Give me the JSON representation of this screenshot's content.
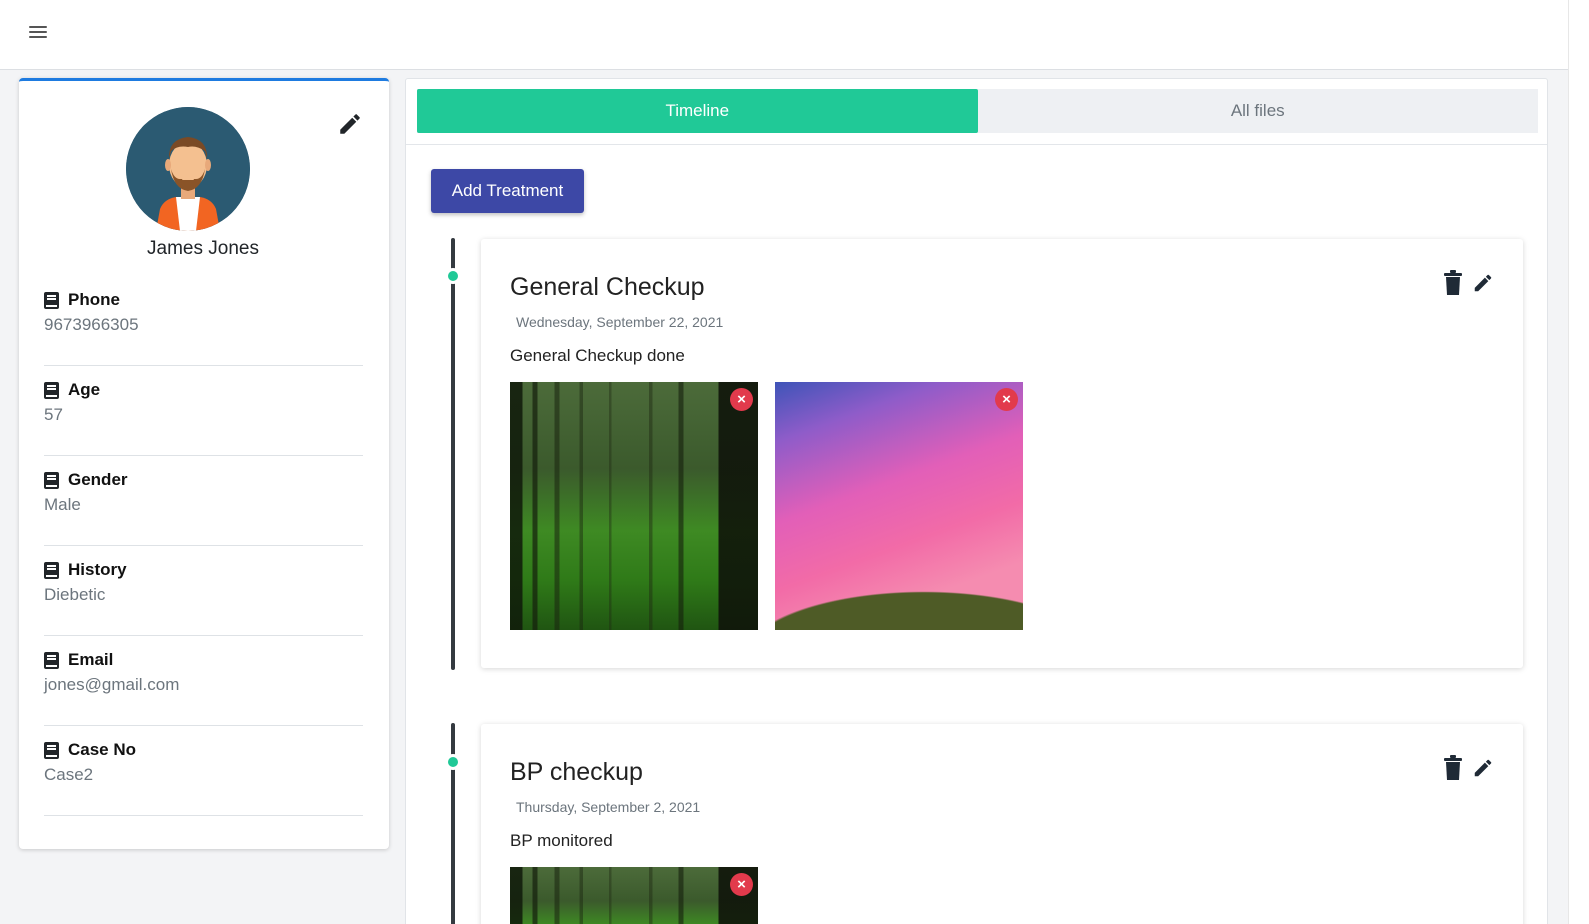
{
  "topbar": {
    "menu_icon": "hamburger-menu-icon"
  },
  "profile": {
    "name": "James Jones",
    "edit_icon": "pencil-icon",
    "fields": [
      {
        "label": "Phone",
        "value": "9673966305",
        "icon": "book-icon"
      },
      {
        "label": "Age",
        "value": "57",
        "icon": "book-icon"
      },
      {
        "label": "Gender",
        "value": "Male",
        "icon": "book-icon"
      },
      {
        "label": "History",
        "value": "Diebetic",
        "icon": "book-icon"
      },
      {
        "label": "Email",
        "value": "jones@gmail.com",
        "icon": "book-icon"
      },
      {
        "label": "Case No",
        "value": "Case2",
        "icon": "book-icon"
      }
    ]
  },
  "tabs": [
    {
      "label": "Timeline",
      "active": true
    },
    {
      "label": "All files",
      "active": false
    }
  ],
  "add_treatment_label": "Add Treatment",
  "treatments": [
    {
      "title": "General Checkup",
      "date": "Wednesday, September 22, 2021",
      "description": "General Checkup done",
      "images": [
        "forest-photo",
        "pink-sky-hill-photo"
      ]
    },
    {
      "title": "BP checkup",
      "date": "Thursday, September 2, 2021",
      "description": "BP monitored",
      "images": [
        "forest-photo"
      ]
    }
  ],
  "colors": {
    "accent_green": "#20c997",
    "button_indigo": "#3d48a6",
    "card_top_border": "#1e7be0",
    "remove_red": "#e23a4c"
  }
}
